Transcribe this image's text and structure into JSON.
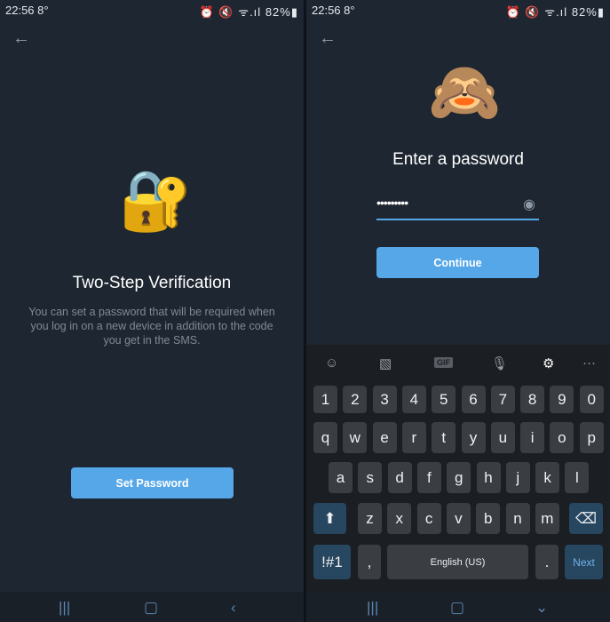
{
  "status": {
    "time": "22:56",
    "temp": "8°",
    "battery": "82%",
    "icons": [
      "alarm-icon",
      "mute-icon",
      "wifi-icon",
      "signal-icon",
      "battery-icon"
    ]
  },
  "left": {
    "emoji": "🔐",
    "title": "Two-Step Verification",
    "description": "You can set a password that will be required when you log in on a new device in addition to the code you get in the SMS.",
    "button": "Set Password"
  },
  "right": {
    "emoji": "🙈",
    "title": "Enter a password",
    "password_value": "•••••••••",
    "button": "Continue"
  },
  "keyboard": {
    "toolbar": [
      "emoji-icon",
      "sticker-icon",
      "gif-icon",
      "microphone-icon",
      "settings-icon",
      "more-icon"
    ],
    "toolbar_gif": "GIF",
    "row1": [
      "1",
      "2",
      "3",
      "4",
      "5",
      "6",
      "7",
      "8",
      "9",
      "0"
    ],
    "row2": [
      "q",
      "w",
      "e",
      "r",
      "t",
      "y",
      "u",
      "i",
      "o",
      "p"
    ],
    "row3": [
      "a",
      "s",
      "d",
      "f",
      "g",
      "h",
      "j",
      "k",
      "l"
    ],
    "row4": [
      "z",
      "x",
      "c",
      "v",
      "b",
      "n",
      "m"
    ],
    "symbols": "!#1",
    "comma": ",",
    "space": "English (US)",
    "period": ".",
    "next": "Next"
  },
  "colors": {
    "accent": "#56a7e8",
    "background": "#1e2631",
    "key": "#3a3d42",
    "special_key": "#27465f"
  }
}
